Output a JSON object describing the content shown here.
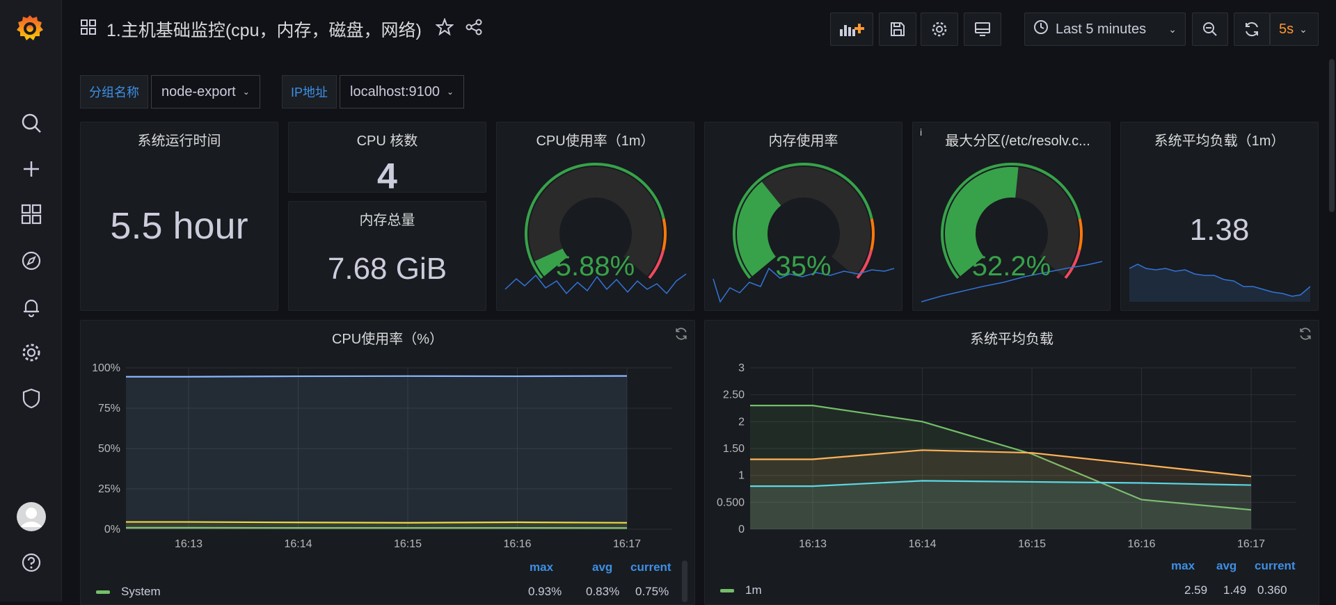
{
  "topbar": {
    "title": "1.主机基础监控(cpu，内存，磁盘，网络)",
    "time_range": "Last 5 minutes",
    "refresh_interval": "5s"
  },
  "variables": [
    {
      "label": "分组名称",
      "value": "node-export"
    },
    {
      "label": "IP地址",
      "value": "localhost:9100"
    }
  ],
  "stats": {
    "uptime": {
      "title": "系统运行时间",
      "value": "5.5 hour"
    },
    "cpu_cores": {
      "title": "CPU 核数",
      "value": "4"
    },
    "mem_total": {
      "title": "内存总量",
      "value": "7.68 GiB"
    },
    "cpu_usage": {
      "title": "CPU使用率（1m）",
      "value": "5.88%",
      "level": 5.88
    },
    "mem_usage": {
      "title": "内存使用率",
      "value": "35%",
      "level": 35
    },
    "disk_usage": {
      "title": "最大分区(/etc/resolv.c...",
      "value": "52.2%",
      "level": 52.2
    },
    "load_avg": {
      "title": "系统平均负载（1m）",
      "value": "1.38"
    }
  },
  "colors": {
    "green": "#37a24a",
    "orange": "#ff780a",
    "red": "#f2495c",
    "blue": "#5794f2",
    "accent_text": "#3d8fe6",
    "refresh": "#ff9830"
  },
  "chart_data": [
    {
      "type": "area",
      "title": "CPU使用率（%）",
      "x": [
        "16:13",
        "16:14",
        "16:15",
        "16:16",
        "16:17"
      ],
      "ylim": [
        0,
        100
      ],
      "y_ticks": [
        "0%",
        "25%",
        "50%",
        "75%",
        "100%"
      ],
      "series": [
        {
          "name": "System",
          "color": "#73bf69",
          "values": [
            0.9,
            0.8,
            0.8,
            0.8,
            0.75
          ]
        },
        {
          "color": "#fade2a",
          "values": [
            4.5,
            4.2,
            4.0,
            4.3,
            4.0
          ]
        },
        {
          "color": "#8ab8ff",
          "values": [
            94.5,
            94.8,
            94.9,
            94.8,
            95.0
          ]
        }
      ],
      "legend": {
        "headers": [
          "max",
          "avg",
          "current"
        ],
        "rows": [
          {
            "name": "System",
            "max": "0.93%",
            "avg": "0.83%",
            "current": "0.75%"
          }
        ]
      }
    },
    {
      "type": "area",
      "title": "系统平均负载",
      "x": [
        "16:13",
        "16:14",
        "16:15",
        "16:16",
        "16:17"
      ],
      "ylim": [
        0,
        3
      ],
      "y_ticks": [
        "0",
        "0.500",
        "1",
        "1.50",
        "2",
        "2.50",
        "3"
      ],
      "series": [
        {
          "name": "1m",
          "color": "#73bf69",
          "values": [
            2.3,
            2.0,
            1.4,
            0.55,
            0.36
          ]
        },
        {
          "color": "#ffb357",
          "values": [
            1.3,
            1.47,
            1.42,
            1.2,
            0.98
          ]
        },
        {
          "color": "#5ad8e6",
          "values": [
            0.8,
            0.9,
            0.88,
            0.86,
            0.82
          ]
        }
      ],
      "legend": {
        "headers": [
          "max",
          "avg",
          "current"
        ],
        "rows": [
          {
            "name": "1m",
            "max": "2.59",
            "avg": "1.49",
            "current": "0.360"
          }
        ]
      }
    }
  ]
}
